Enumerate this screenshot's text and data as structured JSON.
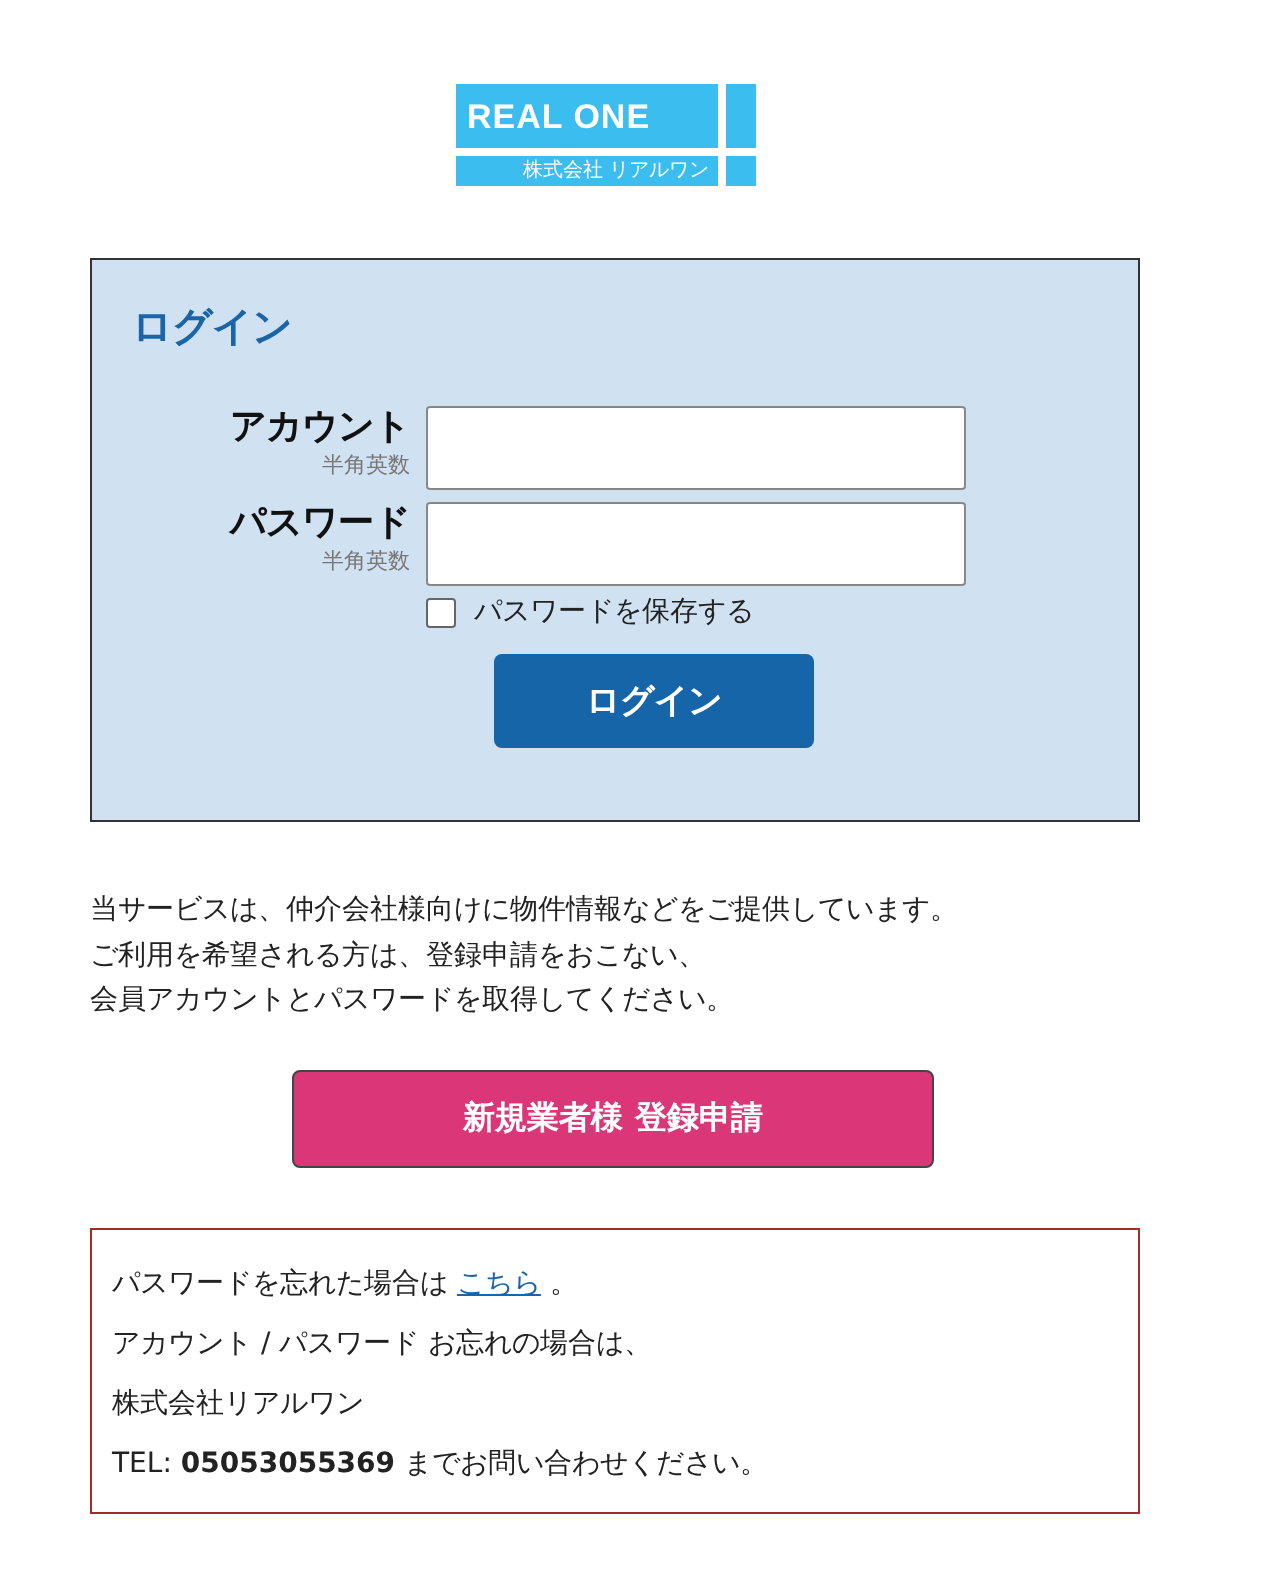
{
  "logo": {
    "title": "REAL ONE",
    "subtitle": "株式会社 リアルワン"
  },
  "login": {
    "title": "ログイン",
    "fields": [
      {
        "label": "アカウント",
        "hint": "半角英数"
      },
      {
        "label": "パスワード",
        "hint": "半角英数"
      }
    ],
    "remember": {
      "label": "パスワードを保存する",
      "checked": false
    },
    "button": "ログイン"
  },
  "intro": [
    "当サービスは、仲介会社様向けに物件情報などをご提供しています。",
    "ご利用を希望される方は、登録申請をおこない、",
    "会員アカウントとパスワードを取得してください。"
  ],
  "register_button": "新規業者様 登録申請",
  "help": {
    "forgot": {
      "before": "パスワードを忘れた場合は ",
      "link": "こちら",
      "after": " 。"
    },
    "lines": [
      "アカウント / パスワード お忘れの場合は、",
      "株式会社リアルワン",
      "TEL: **05053055369** までお問い合わせください。"
    ]
  }
}
